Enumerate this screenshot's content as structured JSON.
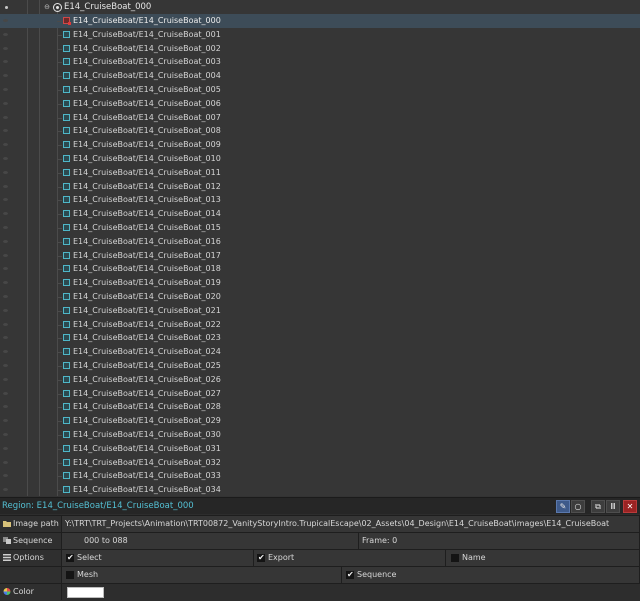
{
  "tree": {
    "root_label": "E14_CruiseBoat_000",
    "selected_index": 0,
    "regions": [
      "E14_CruiseBoat/E14_CruiseBoat_000",
      "E14_CruiseBoat/E14_CruiseBoat_001",
      "E14_CruiseBoat/E14_CruiseBoat_002",
      "E14_CruiseBoat/E14_CruiseBoat_003",
      "E14_CruiseBoat/E14_CruiseBoat_004",
      "E14_CruiseBoat/E14_CruiseBoat_005",
      "E14_CruiseBoat/E14_CruiseBoat_006",
      "E14_CruiseBoat/E14_CruiseBoat_007",
      "E14_CruiseBoat/E14_CruiseBoat_008",
      "E14_CruiseBoat/E14_CruiseBoat_009",
      "E14_CruiseBoat/E14_CruiseBoat_010",
      "E14_CruiseBoat/E14_CruiseBoat_011",
      "E14_CruiseBoat/E14_CruiseBoat_012",
      "E14_CruiseBoat/E14_CruiseBoat_013",
      "E14_CruiseBoat/E14_CruiseBoat_014",
      "E14_CruiseBoat/E14_CruiseBoat_015",
      "E14_CruiseBoat/E14_CruiseBoat_016",
      "E14_CruiseBoat/E14_CruiseBoat_017",
      "E14_CruiseBoat/E14_CruiseBoat_018",
      "E14_CruiseBoat/E14_CruiseBoat_019",
      "E14_CruiseBoat/E14_CruiseBoat_020",
      "E14_CruiseBoat/E14_CruiseBoat_021",
      "E14_CruiseBoat/E14_CruiseBoat_022",
      "E14_CruiseBoat/E14_CruiseBoat_023",
      "E14_CruiseBoat/E14_CruiseBoat_024",
      "E14_CruiseBoat/E14_CruiseBoat_025",
      "E14_CruiseBoat/E14_CruiseBoat_026",
      "E14_CruiseBoat/E14_CruiseBoat_027",
      "E14_CruiseBoat/E14_CruiseBoat_028",
      "E14_CruiseBoat/E14_CruiseBoat_029",
      "E14_CruiseBoat/E14_CruiseBoat_030",
      "E14_CruiseBoat/E14_CruiseBoat_031",
      "E14_CruiseBoat/E14_CruiseBoat_032",
      "E14_CruiseBoat/E14_CruiseBoat_033",
      "E14_CruiseBoat/E14_CruiseBoat_034"
    ]
  },
  "panel": {
    "title": "Region: E14_CruiseBoat/E14_CruiseBoat_000",
    "toolbar": [
      {
        "name": "edit-button",
        "glyph": "✎",
        "active": true
      },
      {
        "name": "pivot-button",
        "glyph": "○",
        "active": false
      },
      {
        "name": "copy-button",
        "glyph": "⧉",
        "active": false
      },
      {
        "name": "rename-button",
        "glyph": "Ⅲ",
        "active": false
      },
      {
        "name": "delete-button",
        "glyph": "✕",
        "active": false
      }
    ],
    "image_path": {
      "label": "Image path",
      "value": "Y:\\TRT\\TRT_Projects\\Animation\\TRT00872_VanityStoryIntro.TrupicalEscape\\02_Assets\\04_Design\\E14_CruiseBoat\\images\\E14_CruiseBoat"
    },
    "sequence": {
      "label": "Sequence",
      "value": "000 to 088",
      "frame": "Frame: 0"
    },
    "options": {
      "label": "Options",
      "select": {
        "label": "Select",
        "checked": true
      },
      "export": {
        "label": "Export",
        "checked": true
      },
      "name": {
        "label": "Name",
        "checked": false
      },
      "mesh": {
        "label": "Mesh",
        "checked": false
      },
      "sequence": {
        "label": "Sequence",
        "checked": true
      }
    },
    "color": {
      "label": "Color",
      "value": "#ffffff"
    }
  }
}
